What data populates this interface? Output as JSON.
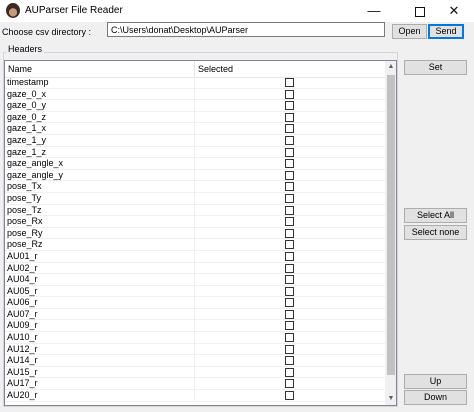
{
  "window": {
    "title": "AUParser File Reader",
    "min_glyph": "—",
    "close_glyph": "✕"
  },
  "directory": {
    "label": "Choose csv directory :",
    "value": "C:\\Users\\donat\\Desktop\\AUParser"
  },
  "buttons": {
    "open": "Open",
    "send": "Send",
    "set": "Set",
    "select_all": "Select All",
    "select_none": "Select none",
    "up": "Up",
    "down": "Down"
  },
  "headers_group": {
    "label": "Headers",
    "columns": [
      "Name",
      "Selected"
    ],
    "rows": [
      {
        "name": "timestamp",
        "selected": false
      },
      {
        "name": "gaze_0_x",
        "selected": false
      },
      {
        "name": "gaze_0_y",
        "selected": false
      },
      {
        "name": "gaze_0_z",
        "selected": false
      },
      {
        "name": "gaze_1_x",
        "selected": false
      },
      {
        "name": "gaze_1_y",
        "selected": false
      },
      {
        "name": "gaze_1_z",
        "selected": false
      },
      {
        "name": "gaze_angle_x",
        "selected": false
      },
      {
        "name": "gaze_angle_y",
        "selected": false
      },
      {
        "name": "pose_Tx",
        "selected": false
      },
      {
        "name": "pose_Ty",
        "selected": false
      },
      {
        "name": "pose_Tz",
        "selected": false
      },
      {
        "name": "pose_Rx",
        "selected": false
      },
      {
        "name": "pose_Ry",
        "selected": false
      },
      {
        "name": "pose_Rz",
        "selected": false
      },
      {
        "name": "AU01_r",
        "selected": false
      },
      {
        "name": "AU02_r",
        "selected": false
      },
      {
        "name": "AU04_r",
        "selected": false
      },
      {
        "name": "AU05_r",
        "selected": false
      },
      {
        "name": "AU06_r",
        "selected": false
      },
      {
        "name": "AU07_r",
        "selected": false
      },
      {
        "name": "AU09_r",
        "selected": false
      },
      {
        "name": "AU10_r",
        "selected": false
      },
      {
        "name": "AU12_r",
        "selected": false
      },
      {
        "name": "AU14_r",
        "selected": false
      },
      {
        "name": "AU15_r",
        "selected": false
      },
      {
        "name": "AU17_r",
        "selected": false
      },
      {
        "name": "AU20_r",
        "selected": false
      }
    ]
  },
  "scrollbar": {
    "up_glyph": "▲",
    "down_glyph": "▼"
  },
  "colors": {
    "window_bg": "#f0f0f0",
    "default_button_border": "#0078d7"
  }
}
